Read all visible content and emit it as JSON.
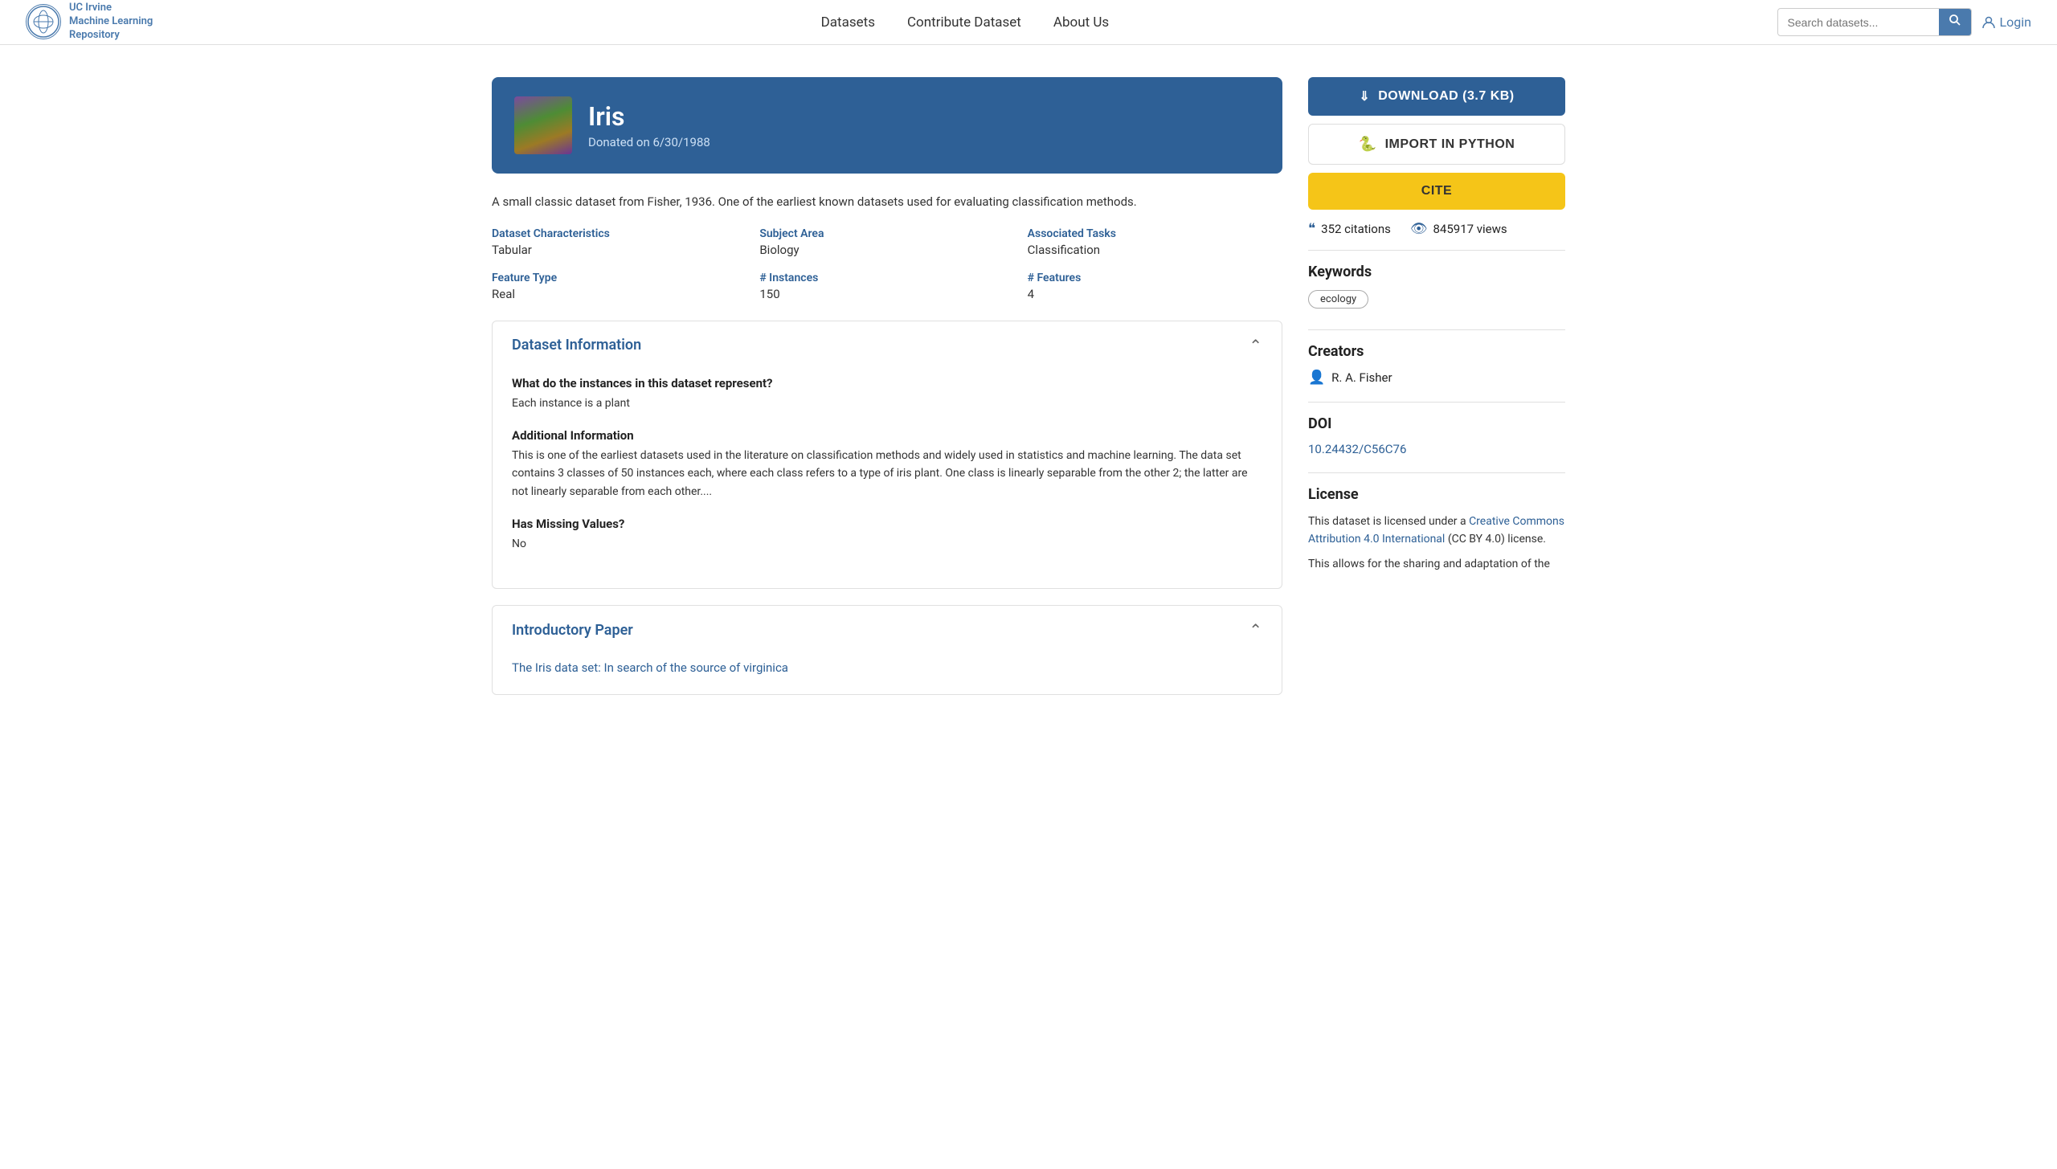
{
  "header": {
    "logo": {
      "line1": "UC Irvine",
      "line2": "Machine Learning",
      "line3": "Repository",
      "symbol": "🔬"
    },
    "nav": [
      {
        "label": "Datasets",
        "href": "#"
      },
      {
        "label": "Contribute Dataset",
        "href": "#"
      },
      {
        "label": "About Us",
        "href": "#"
      }
    ],
    "search_placeholder": "Search datasets...",
    "login_label": "Login"
  },
  "dataset": {
    "title": "Iris",
    "donated": "Donated on 6/30/1988",
    "description": "A small classic dataset from Fisher, 1936. One of the earliest known datasets used for evaluating classification methods.",
    "characteristics_label": "Dataset Characteristics",
    "characteristics_value": "Tabular",
    "subject_label": "Subject Area",
    "subject_value": "Biology",
    "tasks_label": "Associated Tasks",
    "tasks_value": "Classification",
    "feature_label": "Feature Type",
    "feature_value": "Real",
    "instances_label": "# Instances",
    "instances_value": "150",
    "features_label": "# Features",
    "features_value": "4"
  },
  "dataset_info": {
    "section_title": "Dataset Information",
    "q1_title": "What do the instances in this dataset represent?",
    "q1_answer": "Each instance is a plant",
    "additional_title": "Additional Information",
    "additional_text": "This is one of the earliest datasets used in the literature on classification methods and widely used in statistics and machine learning.  The data set contains 3 classes of 50 instances each, where each class refers to a type of iris plant.  One class is linearly separable from the other 2; the latter are not linearly separable from each other....",
    "missing_title": "Has Missing Values?",
    "missing_value": "No"
  },
  "intro_paper": {
    "section_title": "Introductory Paper",
    "paper_link": "The Iris data set: In search of the source of virginica"
  },
  "sidebar": {
    "download_label": "DOWNLOAD  (3.7 KB)",
    "import_label": "IMPORT IN PYTHON",
    "cite_label": "CITE",
    "citations_count": "352 citations",
    "views_count": "845917 views",
    "keywords_title": "Keywords",
    "keywords": [
      "ecology"
    ],
    "creators_title": "Creators",
    "creator_name": "R. A. Fisher",
    "doi_title": "DOI",
    "doi_value": "10.24432/C56C76",
    "doi_href": "#",
    "license_title": "License",
    "license_text_before": "This dataset is licensed under a ",
    "license_name": "Creative Commons Attribution 4.0 International",
    "license_text_after": " (CC BY 4.0) license.",
    "license_text2": "This allows for the sharing and adaptation of the"
  }
}
